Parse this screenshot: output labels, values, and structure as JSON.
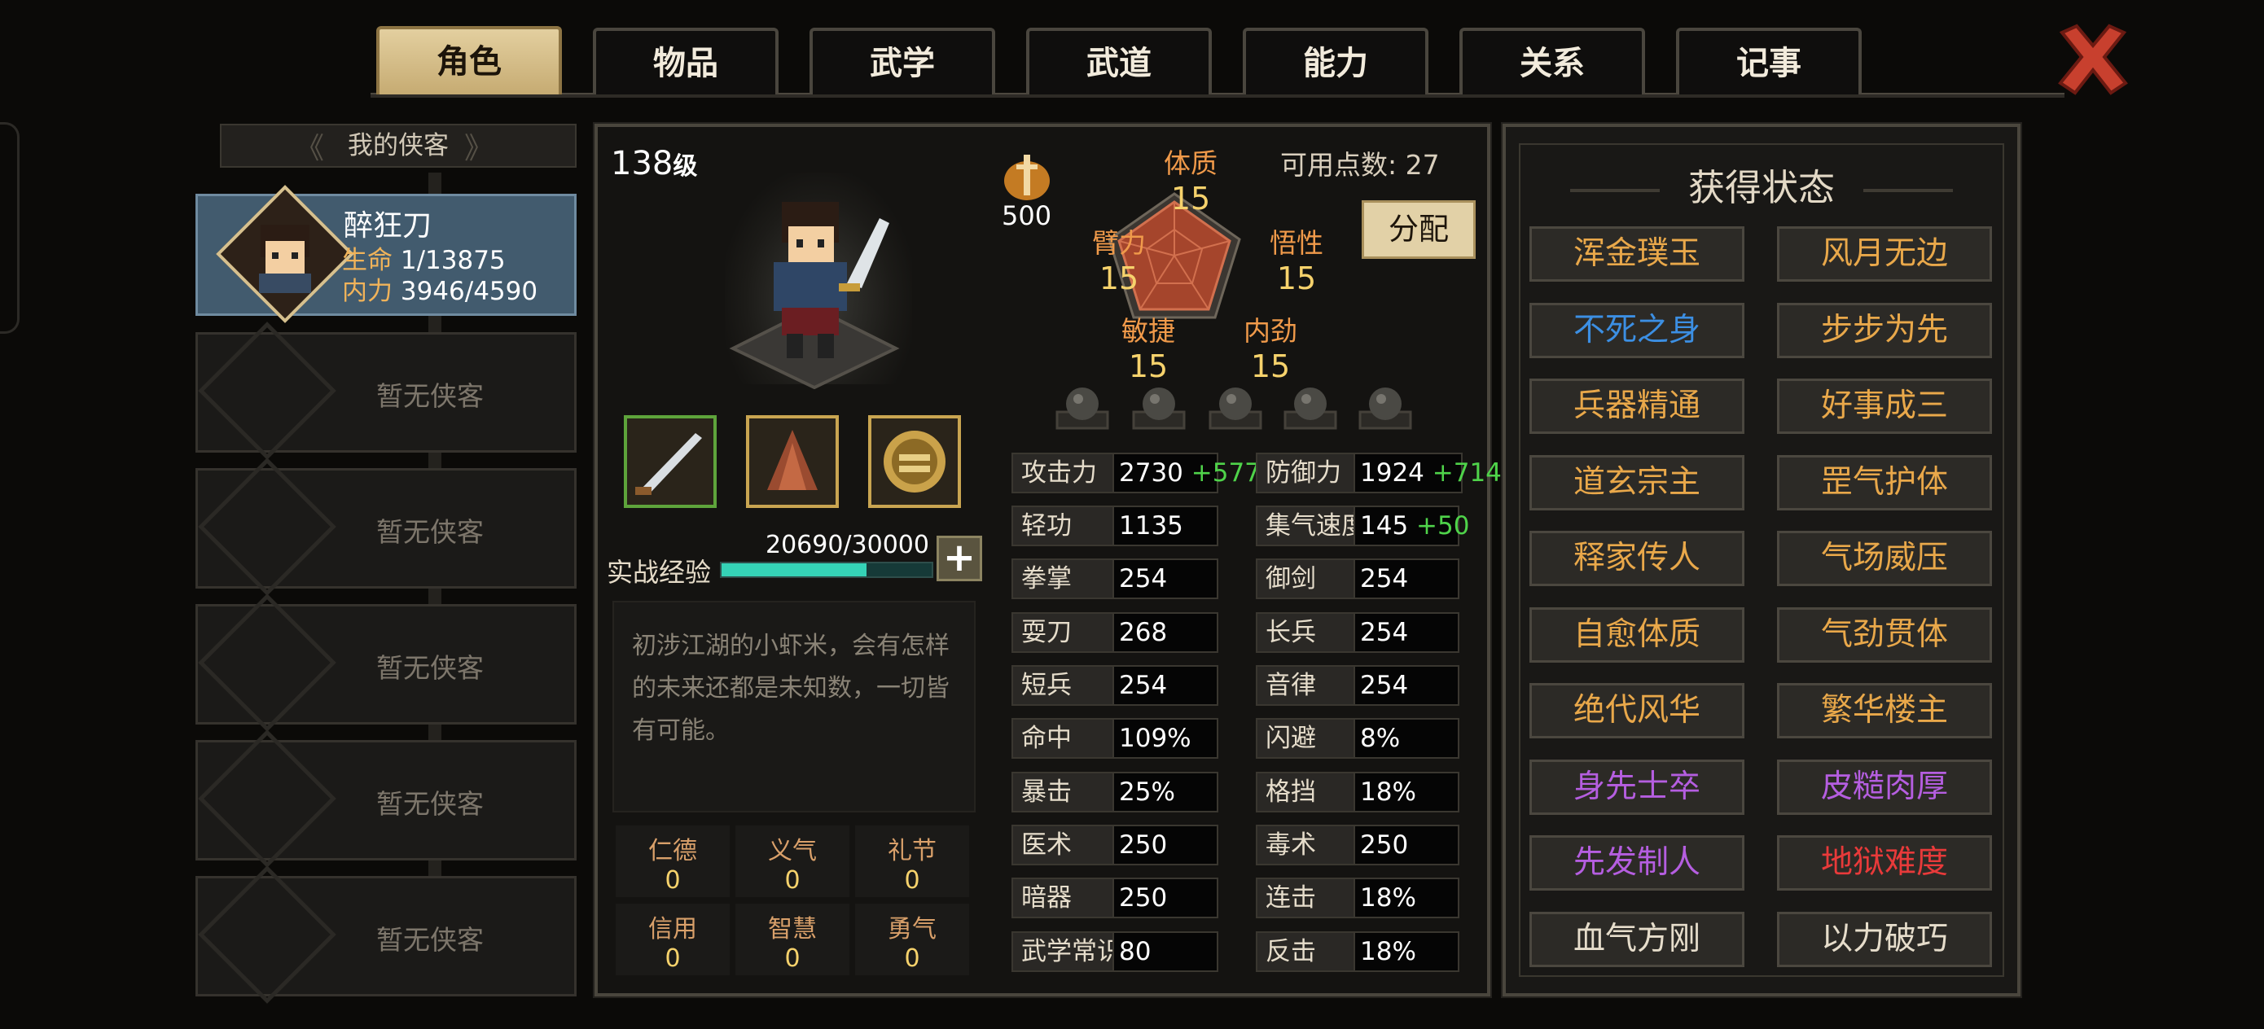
{
  "tabs": [
    "角色",
    "物品",
    "武学",
    "武道",
    "能力",
    "关系",
    "记事"
  ],
  "active_tab": 0,
  "roster": {
    "title": "我的侠客",
    "hero": {
      "name": "醉狂刀",
      "hp_label": "生命",
      "hp": "1/13875",
      "mp_label": "内力",
      "mp": "3946/4590"
    },
    "empty_label": "暂无侠客"
  },
  "character": {
    "level": "138",
    "level_suffix": "级",
    "weapon_power": "500",
    "available_points_label": "可用点数:",
    "available_points": "27",
    "assign_label": "分配",
    "attributes": [
      {
        "label": "体质",
        "value": "15"
      },
      {
        "label": "臂力",
        "value": "15"
      },
      {
        "label": "悟性",
        "value": "15"
      },
      {
        "label": "敏捷",
        "value": "15"
      },
      {
        "label": "内劲",
        "value": "15"
      }
    ],
    "exp_label": "实战经验",
    "exp_value": "20690/30000",
    "exp_progress": 0.69,
    "description": "初涉江湖的小虾米，会有怎样的未来还都是未知数，一切皆有可能。",
    "virtues": [
      {
        "label": "仁德",
        "value": "0"
      },
      {
        "label": "义气",
        "value": "0"
      },
      {
        "label": "礼节",
        "value": "0"
      },
      {
        "label": "信用",
        "value": "0"
      },
      {
        "label": "智慧",
        "value": "0"
      },
      {
        "label": "勇气",
        "value": "0"
      }
    ]
  },
  "stats_left": [
    {
      "label": "攻击力",
      "value": "2730",
      "bonus": "+577"
    },
    {
      "label": "轻功",
      "value": "1135",
      "bonus": ""
    },
    {
      "label": "拳掌",
      "value": "254",
      "bonus": ""
    },
    {
      "label": "耍刀",
      "value": "268",
      "bonus": ""
    },
    {
      "label": "短兵",
      "value": "254",
      "bonus": ""
    },
    {
      "label": "命中",
      "value": "109%",
      "bonus": ""
    },
    {
      "label": "暴击",
      "value": "25%",
      "bonus": ""
    },
    {
      "label": "医术",
      "value": "250",
      "bonus": ""
    },
    {
      "label": "暗器",
      "value": "250",
      "bonus": ""
    },
    {
      "label": "武学常识",
      "value": "80",
      "bonus": ""
    }
  ],
  "stats_right": [
    {
      "label": "防御力",
      "value": "1924",
      "bonus": "+714"
    },
    {
      "label": "集气速度",
      "value": "145",
      "bonus": "+50"
    },
    {
      "label": "御剑",
      "value": "254",
      "bonus": ""
    },
    {
      "label": "长兵",
      "value": "254",
      "bonus": ""
    },
    {
      "label": "音律",
      "value": "254",
      "bonus": ""
    },
    {
      "label": "闪避",
      "value": "8%",
      "bonus": ""
    },
    {
      "label": "格挡",
      "value": "18%",
      "bonus": ""
    },
    {
      "label": "毒术",
      "value": "250",
      "bonus": ""
    },
    {
      "label": "连击",
      "value": "18%",
      "bonus": ""
    },
    {
      "label": "反击",
      "value": "18%",
      "bonus": ""
    }
  ],
  "status": {
    "title": "获得状态",
    "items": [
      {
        "label": "浑金璞玉",
        "color": "#e9a84a"
      },
      {
        "label": "风月无边",
        "color": "#e9a84a"
      },
      {
        "label": "不死之身",
        "color": "#3c8fe3"
      },
      {
        "label": "步步为先",
        "color": "#e9a84a"
      },
      {
        "label": "兵器精通",
        "color": "#e9a84a"
      },
      {
        "label": "好事成三",
        "color": "#e9a84a"
      },
      {
        "label": "道玄宗主",
        "color": "#e9a84a"
      },
      {
        "label": "罡气护体",
        "color": "#e9a84a"
      },
      {
        "label": "释家传人",
        "color": "#e9a84a"
      },
      {
        "label": "气场威压",
        "color": "#e9a84a"
      },
      {
        "label": "自愈体质",
        "color": "#e9a84a"
      },
      {
        "label": "气劲贯体",
        "color": "#e9a84a"
      },
      {
        "label": "绝代风华",
        "color": "#e9a84a"
      },
      {
        "label": "繁华楼主",
        "color": "#e9a84a"
      },
      {
        "label": "身先士卒",
        "color": "#b55ee0"
      },
      {
        "label": "皮糙肉厚",
        "color": "#b55ee0"
      },
      {
        "label": "先发制人",
        "color": "#b55ee0"
      },
      {
        "label": "地狱难度",
        "color": "#e83a3a"
      },
      {
        "label": "血气方刚",
        "color": "#e6ddcb"
      },
      {
        "label": "以力破巧",
        "color": "#e6ddcb"
      }
    ]
  }
}
